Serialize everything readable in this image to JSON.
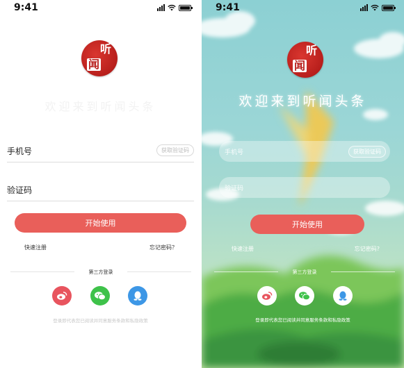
{
  "status_bar": {
    "time": "9:41"
  },
  "logo": {
    "char_top": "听",
    "char_bottom": "闻"
  },
  "welcome": "欢迎来到听闻头条",
  "form": {
    "phone_label": "手机号",
    "get_code_label": "获取验证码",
    "code_label": "验证码",
    "start_label": "开始使用",
    "register_label": "快速注册",
    "forgot_light": "忘记密码？",
    "forgot_dark": "忘记密码?"
  },
  "third_party": {
    "title": "第三方登录",
    "items": [
      {
        "icon": "weibo-icon",
        "color": "#e8545e"
      },
      {
        "icon": "wechat-icon",
        "color": "#3ec24a"
      },
      {
        "icon": "qq-icon",
        "color": "#3d97e6"
      }
    ]
  },
  "legal": "登录即代表您已阅读并同意服务条款和私隐政策",
  "colors": {
    "accent": "#e95f5a",
    "logo_red": "#b81f1c",
    "sky": "#8cd0d3"
  }
}
